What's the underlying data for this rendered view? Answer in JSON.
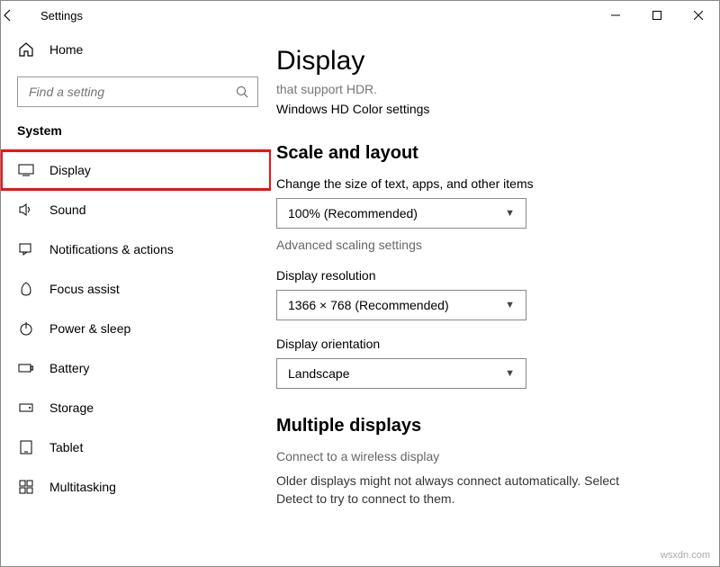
{
  "window": {
    "title": "Settings"
  },
  "sidebar": {
    "home": "Home",
    "search_placeholder": "Find a setting",
    "section": "System",
    "items": [
      {
        "label": "Display"
      },
      {
        "label": "Sound"
      },
      {
        "label": "Notifications & actions"
      },
      {
        "label": "Focus assist"
      },
      {
        "label": "Power & sleep"
      },
      {
        "label": "Battery"
      },
      {
        "label": "Storage"
      },
      {
        "label": "Tablet"
      },
      {
        "label": "Multitasking"
      }
    ]
  },
  "main": {
    "title": "Display",
    "hdr_truncated": "that support HDR.",
    "hdr_link": "Windows HD Color settings",
    "scale": {
      "heading": "Scale and layout",
      "size_label": "Change the size of text, apps, and other items",
      "size_value": "100% (Recommended)",
      "advanced_link": "Advanced scaling settings",
      "resolution_label": "Display resolution",
      "resolution_value": "1366 × 768 (Recommended)",
      "orientation_label": "Display orientation",
      "orientation_value": "Landscape"
    },
    "multi": {
      "heading": "Multiple displays",
      "wireless": "Connect to a wireless display",
      "hint": "Older displays might not always connect automatically. Select Detect to try to connect to them."
    }
  },
  "watermark": "wsxdn.com"
}
